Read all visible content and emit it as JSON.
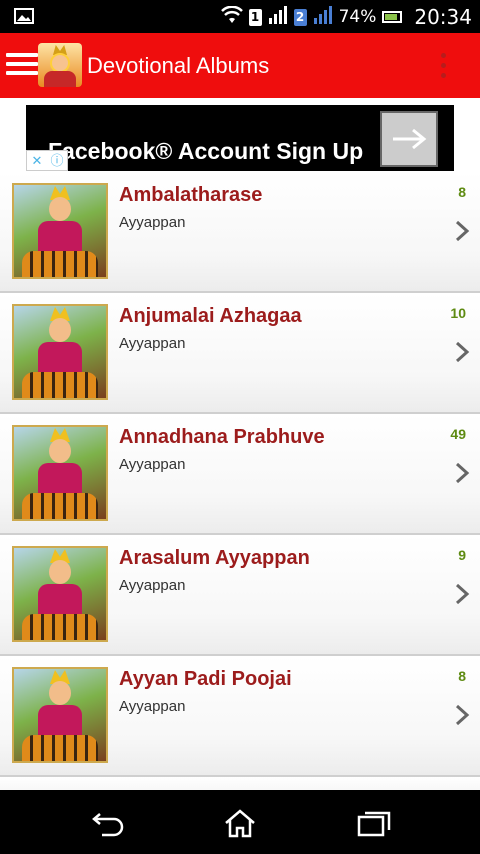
{
  "status_bar": {
    "time": "20:34",
    "battery": "74%",
    "sim1_label": "1",
    "sim2_label": "2",
    "icons": [
      "gallery-icon",
      "wifi-icon",
      "signal-icon",
      "battery-icon"
    ]
  },
  "app_bar": {
    "title": "Devotional Albums",
    "icons": [
      "menu-icon",
      "app-logo",
      "overflow-menu-icon"
    ]
  },
  "ad": {
    "text": "Facebook® Account Sign Up",
    "badge_close": "✕",
    "badge_info": "ⓘ"
  },
  "albums": [
    {
      "title": "Ambalatharase",
      "artist": "Ayyappan",
      "count": "8"
    },
    {
      "title": "Anjumalai Azhagaa",
      "artist": "Ayyappan",
      "count": "10"
    },
    {
      "title": "Annadhana Prabhuve",
      "artist": "Ayyappan",
      "count": "49"
    },
    {
      "title": "Arasalum Ayyappan",
      "artist": "Ayyappan",
      "count": "9"
    },
    {
      "title": "Ayyan Padi Poojai",
      "artist": "Ayyappan",
      "count": "8"
    }
  ],
  "nav_bar": {
    "icons": [
      "back-icon",
      "home-icon",
      "recents-icon"
    ]
  },
  "colors": {
    "app_bar": "#ef0d0d",
    "title_text": "#9c1c1c",
    "count_text": "#5e8b12"
  }
}
